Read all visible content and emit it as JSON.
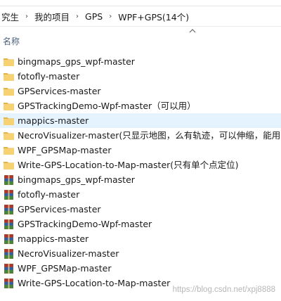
{
  "ribbon": {
    "fragments": [
      "",
      "",
      "",
      ""
    ]
  },
  "address": {
    "crumbs": [
      "究生",
      "我的项目",
      "GPS",
      "WPF+GPS(14个)"
    ],
    "separator": "›"
  },
  "columns": {
    "name_header": "名称"
  },
  "files": [
    {
      "name": "bingmaps_gps_wpf-master",
      "type": "folder"
    },
    {
      "name": "fotofly-master",
      "type": "folder"
    },
    {
      "name": "GPServices-master",
      "type": "folder"
    },
    {
      "name": "GPSTrackingDemo-Wpf-master（可以用）",
      "type": "folder"
    },
    {
      "name": "mappics-master",
      "type": "folder",
      "hovered": true
    },
    {
      "name": "NecroVisualizer-master(只显示地图，么有轨迹，可以伸缩，能用)",
      "type": "folder"
    },
    {
      "name": "WPF_GPSMap-master",
      "type": "folder"
    },
    {
      "name": "Write-GPS-Location-to-Map-master(只有单个点定位)",
      "type": "folder"
    },
    {
      "name": "bingmaps_gps_wpf-master",
      "type": "archive"
    },
    {
      "name": "fotofly-master",
      "type": "archive"
    },
    {
      "name": "GPServices-master",
      "type": "archive"
    },
    {
      "name": "GPSTrackingDemo-Wpf-master",
      "type": "archive"
    },
    {
      "name": "mappics-master",
      "type": "archive"
    },
    {
      "name": "NecroVisualizer-master",
      "type": "archive"
    },
    {
      "name": "WPF_GPSMap-master",
      "type": "archive"
    },
    {
      "name": "Write-GPS-Location-to-Map-master",
      "type": "archive"
    }
  ],
  "icons": {
    "folder": "folder-icon",
    "archive": "archive-icon"
  },
  "colors": {
    "folder": "#f7d272",
    "folder_dark": "#e0b449",
    "archive_red": "#b3302d",
    "archive_blue": "#2d5fa8",
    "archive_green": "#3c8a3a",
    "hover_bg": "#e5f3ff",
    "header_text": "#4c607a"
  },
  "watermark": "https://blog.csdn.net/xpj8888"
}
